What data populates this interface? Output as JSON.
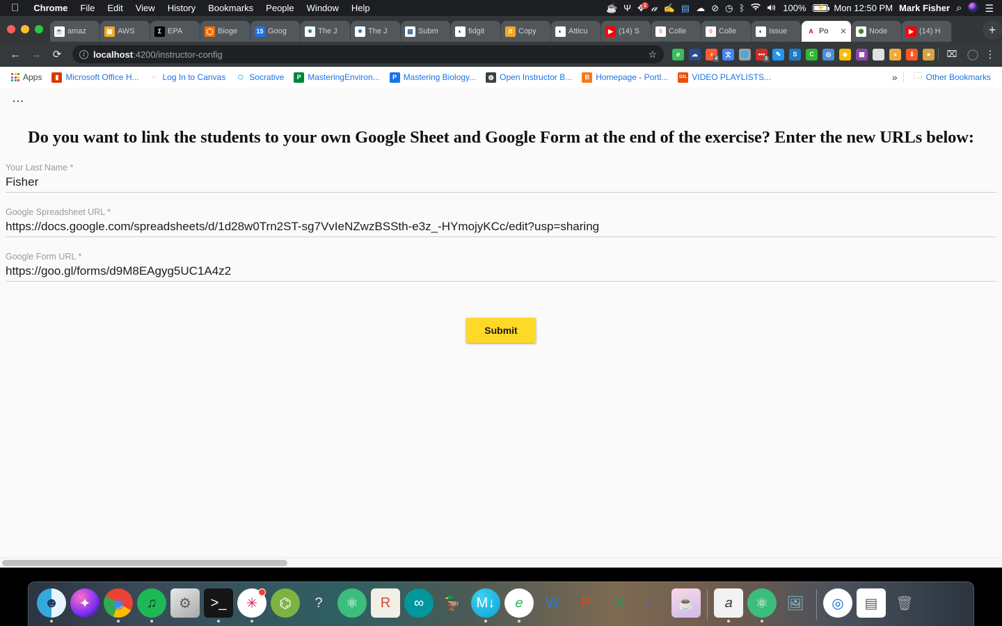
{
  "menubar": {
    "apple": "",
    "items": [
      {
        "label": "Chrome",
        "bold": true
      },
      {
        "label": "File",
        "bold": false
      },
      {
        "label": "Edit",
        "bold": false
      },
      {
        "label": "View",
        "bold": false
      },
      {
        "label": "History",
        "bold": false
      },
      {
        "label": "Bookmarks",
        "bold": false
      },
      {
        "label": "People",
        "bold": false
      },
      {
        "label": "Window",
        "bold": false
      },
      {
        "label": "Help",
        "bold": false
      }
    ],
    "status": {
      "coffee_icon": "☕",
      "antenna_icon": "Ψ",
      "dropbox_icon": "✥",
      "evernote_icon": "𝒶",
      "paint_icon": "✍",
      "doc_icon": "▤",
      "cloud_icon": "☁",
      "dnd_icon": "⊘",
      "timemachine_icon": "◷",
      "bluetooth_icon": "ᛒ",
      "wifi_icon": "◞",
      "volume_icon": "🔊",
      "battery_percent": "100%",
      "battery_icon": "battery-charging-icon",
      "datetime": "Mon 12:50 PM",
      "user": "Mark Fisher",
      "search_icon": "⌕",
      "siri_icon": "◉",
      "notification_icon": "☰"
    }
  },
  "chrome": {
    "tabs": [
      {
        "label": "amaz",
        "fav": "☕",
        "fav_bg": "#ffffff",
        "fav_color": "#d97706",
        "active": false
      },
      {
        "label": "AWS",
        "fav": "▣",
        "fav_bg": "#f5a623",
        "fav_color": "#ffffff",
        "active": false
      },
      {
        "label": "EPA ",
        "fav": "Σ",
        "fav_bg": "#000000",
        "fav_color": "#ffffff",
        "active": false
      },
      {
        "label": "Bioge",
        "fav": "◯",
        "fav_bg": "#ff6a00",
        "fav_color": "#ffffff",
        "active": false
      },
      {
        "label": "Goog",
        "fav": "15",
        "fav_bg": "#1a73e8",
        "fav_color": "#ffffff",
        "active": false
      },
      {
        "label": "The J",
        "fav": "✷",
        "fav_bg": "#ffffff",
        "fav_color": "#0a8a3c",
        "active": false
      },
      {
        "label": "The J",
        "fav": "✷",
        "fav_bg": "#ffffff",
        "fav_color": "#1f6fb5",
        "active": false
      },
      {
        "label": "Subm",
        "fav": "▦",
        "fav_bg": "#ffffff",
        "fav_color": "#2f6fae",
        "active": false
      },
      {
        "label": "fidgit",
        "fav": "◐",
        "fav_bg": "#ffffff",
        "fav_color": "#1b1f23",
        "active": false
      },
      {
        "label": "Copy",
        "fav": "/t",
        "fav_bg": "#f5a623",
        "fav_color": "#ffffff",
        "active": false
      },
      {
        "label": "Atticu",
        "fav": "◐",
        "fav_bg": "#ffffff",
        "fav_color": "#1b1f23",
        "active": false
      },
      {
        "label": "(14) S",
        "fav": "▶",
        "fav_bg": "#ff0000",
        "fav_color": "#ffffff",
        "active": false
      },
      {
        "label": "Colle",
        "fav": "◊",
        "fav_bg": "#ffffff",
        "fav_color": "#f26522",
        "active": false
      },
      {
        "label": "Colle",
        "fav": "◊",
        "fav_bg": "#ffffff",
        "fav_color": "#f26522",
        "active": false
      },
      {
        "label": "Issue",
        "fav": "◐",
        "fav_bg": "#ffffff",
        "fav_color": "#1b1f23",
        "active": false
      },
      {
        "label": "Po",
        "fav": "A",
        "fav_bg": "#ffffff",
        "fav_color": "#dd0031",
        "active": true
      },
      {
        "label": "Node",
        "fav": "⬢",
        "fav_bg": "#ffffff",
        "fav_color": "#43853d",
        "active": false
      },
      {
        "label": "(14) H",
        "fav": "▶",
        "fav_bg": "#ff0000",
        "fav_color": "#ffffff",
        "active": false
      }
    ],
    "newtab_label": "+",
    "nav": {
      "back_icon": "←",
      "forward_icon": "→",
      "reload_icon": "⟳"
    },
    "omnibox": {
      "info_icon": "i",
      "url_host": "localhost",
      "url_path": ":4200/instructor-config",
      "star_icon": "☆"
    },
    "extensions": [
      {
        "name": "evernote-extension",
        "glyph": "𝑒",
        "bg": "#3bbd5c",
        "count": ""
      },
      {
        "name": "onedrive-extension",
        "glyph": "☁",
        "bg": "#2a4b8d",
        "count": ""
      },
      {
        "name": "hubspot-extension",
        "glyph": "◖",
        "bg": "#ff5c35",
        "count": "4"
      },
      {
        "name": "google-translate-extension",
        "glyph": "文",
        "bg": "#4285f4",
        "count": ""
      },
      {
        "name": "globe-extension",
        "glyph": "🌐",
        "bg": "#9aa0a6",
        "count": ""
      },
      {
        "name": "lastpass-extension",
        "glyph": "•••",
        "bg": "#d32d27",
        "count": "3"
      },
      {
        "name": "eyedropper-extension",
        "glyph": "✎",
        "bg": "#2196f3",
        "count": ""
      },
      {
        "name": "scribd-extension",
        "glyph": "S",
        "bg": "#1e7bc4",
        "count": ""
      },
      {
        "name": "cors-extension",
        "glyph": "C",
        "bg": "#2eb82e",
        "count": ""
      },
      {
        "name": "opera-extension",
        "glyph": "◎",
        "bg": "#4a90d9",
        "count": ""
      },
      {
        "name": "google-keep-extension",
        "glyph": "◆",
        "bg": "#fbbc04",
        "count": ""
      },
      {
        "name": "chart-extension",
        "glyph": "▦",
        "bg": "#8e44ad",
        "count": ""
      },
      {
        "name": "home-extension",
        "glyph": "⌂",
        "bg": "#e0e0e0",
        "count": ""
      },
      {
        "name": "nerd-extension",
        "glyph": "◕",
        "bg": "#f4a93c",
        "count": ""
      },
      {
        "name": "download-extension",
        "glyph": "⬇",
        "bg": "#ff5722",
        "count": ""
      },
      {
        "name": "cookie-extension",
        "glyph": "●",
        "bg": "#d9a441",
        "count": ""
      }
    ],
    "cast_icon": "⌧",
    "profile_icon": "◯",
    "menu_icon": "⋮"
  },
  "bookmarks": {
    "items": [
      {
        "label": "Apps",
        "fav": "grid-icon",
        "bg": "",
        "color": "",
        "glyph": ""
      },
      {
        "label": "Microsoft Office H...",
        "fav": "office-icon",
        "bg": "#d83b01",
        "color": "#ffffff",
        "glyph": "▮"
      },
      {
        "label": "Log In to Canvas",
        "fav": "canvas-icon",
        "bg": "#ffffff",
        "color": "#e03e2d",
        "glyph": "◌"
      },
      {
        "label": "Socrative",
        "fav": "socrative-icon",
        "bg": "#ffffff",
        "color": "#5ab4d6",
        "glyph": "⬡"
      },
      {
        "label": "MasteringEnviron...",
        "fav": "pearson-icon",
        "bg": "#00843d",
        "color": "#ffffff",
        "glyph": "P"
      },
      {
        "label": "Mastering Biology...",
        "fav": "pearson-blue-icon",
        "bg": "#1a73e8",
        "color": "#ffffff",
        "glyph": "P"
      },
      {
        "label": "Open Instructor B...",
        "fav": "globe-icon",
        "bg": "#3c4043",
        "color": "#ffffff",
        "glyph": "◍"
      },
      {
        "label": "Homepage - Portl...",
        "fav": "orange-b-icon",
        "bg": "#f47b20",
        "color": "#ffffff",
        "glyph": "B"
      },
      {
        "label": "VIDEO PLAYLISTS...",
        "fav": "d2l-icon",
        "bg": "#e8500e",
        "color": "#ffffff",
        "glyph": "D2L"
      }
    ],
    "overflow_icon": "»",
    "other_folder_icon": "🗀",
    "other_label": "Other Bookmarks"
  },
  "page": {
    "kebab_icon": "⋮",
    "title": "Do you want to link the students to your own Google Sheet and Google Form at the end of the exercise? Enter the new URLs below:",
    "fields": [
      {
        "label": "Your Last Name *",
        "value": "Fisher",
        "placeholder": "Your Last Name",
        "name": "last-name-field"
      },
      {
        "label": "Google Spreadsheet URL *",
        "value": "https://docs.google.com/spreadsheets/d/1d28w0Trn2ST-sg7VvIeNZwzBSSth-e3z_-HYmojyKCc/edit?usp=sharing",
        "placeholder": "Google Spreadsheet URL",
        "name": "spreadsheet-url-field"
      },
      {
        "label": "Google Form URL *",
        "value": "https://goo.gl/forms/d9M8EAgyg5UC1A4z2",
        "placeholder": "Google Form URL",
        "name": "form-url-field"
      }
    ],
    "submit_label": "Submit",
    "submit_color": "#ffd927"
  },
  "dock": {
    "items": [
      {
        "name": "finder",
        "glyph": "☻",
        "bg": "linear-gradient(90deg,#34aadc 50%,#e8f4fb 50%)",
        "color": "#1f3a5f",
        "running": true,
        "badge": ""
      },
      {
        "name": "siri",
        "glyph": "✦",
        "bg": "radial-gradient(circle at 35% 30%,#ff6ec7,#7b2ff7 60%,#1a1a2e)",
        "color": "#ffffff",
        "running": false,
        "badge": ""
      },
      {
        "name": "google-chrome",
        "glyph": "◉",
        "bg": "conic-gradient(#ea4335 0deg 120deg,#fbbc05 120deg 200deg,#34a853 200deg 300deg,#ea4335 300deg 360deg)",
        "color": "#4285f4",
        "running": true,
        "badge": ""
      },
      {
        "name": "spotify",
        "glyph": "♫",
        "bg": "#1db954",
        "color": "#0b3d1f",
        "running": true,
        "badge": ""
      },
      {
        "name": "system-preferences",
        "glyph": "⚙",
        "bg": "linear-gradient(145deg,#e8e8e8,#a9a9a9)",
        "color": "#5a5a5a",
        "running": false,
        "badge": ""
      },
      {
        "name": "terminal",
        "glyph": ">_",
        "bg": "#151515",
        "color": "#ffffff",
        "running": true,
        "badge": ""
      },
      {
        "name": "slack",
        "glyph": "✳",
        "bg": "#ffffff",
        "color": "#e01e5a",
        "running": true,
        "badge": "1"
      },
      {
        "name": "android-studio",
        "glyph": "⌬",
        "bg": "#7cb342",
        "color": "#ffffff",
        "running": false,
        "badge": ""
      },
      {
        "name": "help-viewer",
        "glyph": "?",
        "bg": "transparent",
        "color": "#e8e8e8",
        "running": false,
        "badge": ""
      },
      {
        "name": "atom",
        "glyph": "⚛",
        "bg": "#3dbd7d",
        "color": "#ffffff",
        "running": false,
        "badge": ""
      },
      {
        "name": "r-studio",
        "glyph": "R",
        "bg": "#f2efe6",
        "color": "#d9453c",
        "running": false,
        "badge": ""
      },
      {
        "name": "arduino",
        "glyph": "∞",
        "bg": "#00979d",
        "color": "#ffffff",
        "running": false,
        "badge": ""
      },
      {
        "name": "cyberduck",
        "glyph": "🦆",
        "bg": "transparent",
        "color": "#f5c518",
        "running": false,
        "badge": ""
      },
      {
        "name": "macdown",
        "glyph": "M↓",
        "bg": "radial-gradient(circle at 35% 30%,#3fd0f0,#0aa3d6)",
        "color": "#ffffff",
        "running": true,
        "badge": ""
      },
      {
        "name": "evernote",
        "glyph": "𝑒",
        "bg": "#ffffff",
        "color": "#2dbe60",
        "running": true,
        "badge": ""
      },
      {
        "name": "microsoft-word",
        "glyph": "W",
        "bg": "transparent",
        "color": "#2b7cd3",
        "running": false,
        "badge": ""
      },
      {
        "name": "microsoft-powerpoint",
        "glyph": "P",
        "bg": "transparent",
        "color": "#e8402a",
        "running": false,
        "badge": ""
      },
      {
        "name": "microsoft-excel",
        "glyph": "X",
        "bg": "transparent",
        "color": "#1f9d55",
        "running": false,
        "badge": ""
      },
      {
        "name": "cyberduck-cat",
        "glyph": "ᓚ",
        "bg": "transparent",
        "color": "#6b5b8c",
        "running": false,
        "badge": ""
      },
      {
        "name": "caffeine-preview",
        "glyph": "☕",
        "bg": "linear-gradient(160deg,#f9d9e8,#d0b9e8)",
        "color": "#5a3a2a",
        "running": false,
        "badge": ""
      },
      {
        "name": "separator-1",
        "glyph": "",
        "bg": "",
        "color": "",
        "running": false,
        "badge": ""
      },
      {
        "name": "notational-velocity",
        "glyph": "𝑎",
        "bg": "#f2f2f2",
        "color": "#3a3a3a",
        "running": true,
        "badge": ""
      },
      {
        "name": "atom-2",
        "glyph": "⚛",
        "bg": "#3dbd7d",
        "color": "#ffffff",
        "running": true,
        "badge": ""
      },
      {
        "name": "preview",
        "glyph": "🖼",
        "bg": "transparent",
        "color": "#7ec8e3",
        "running": false,
        "badge": ""
      },
      {
        "name": "separator-2",
        "glyph": "",
        "bg": "",
        "color": "",
        "running": false,
        "badge": ""
      },
      {
        "name": "1password",
        "glyph": "◎",
        "bg": "#ffffff",
        "color": "#0a6ed1",
        "running": false,
        "badge": ""
      },
      {
        "name": "downloads-stack",
        "glyph": "▤",
        "bg": "#ffffff",
        "color": "#5a5a5a",
        "running": false,
        "badge": ""
      },
      {
        "name": "trash",
        "glyph": "🗑",
        "bg": "transparent",
        "color": "#9aa0a6",
        "running": false,
        "badge": ""
      }
    ]
  }
}
